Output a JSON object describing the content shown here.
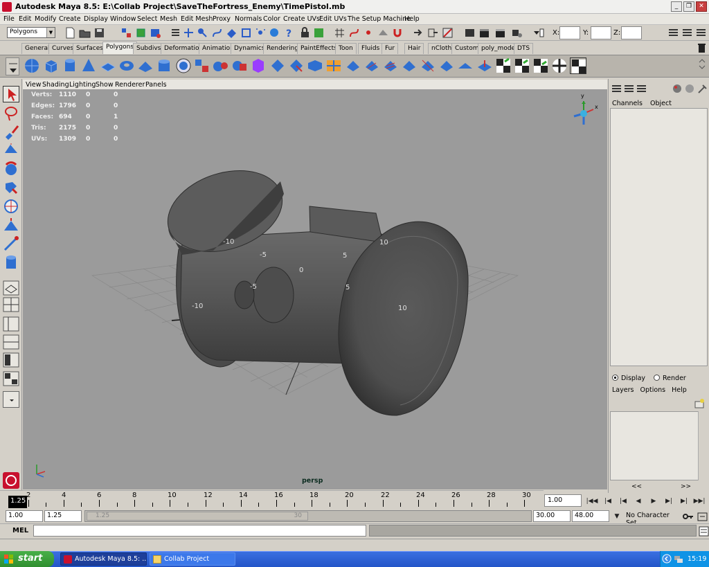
{
  "window": {
    "title": "Autodesk Maya 8.5: E:\\Collab Project\\SaveTheFortress_Enemy\\TimePistol.mb"
  },
  "menubar": [
    "File",
    "Edit",
    "Modify",
    "Create",
    "Display",
    "Window",
    "Select",
    "Mesh",
    "Edit Mesh",
    "Proxy",
    "Normals",
    "Color",
    "Create UVs",
    "Edit UVs",
    "The Setup Machine",
    "Help"
  ],
  "status_line": {
    "mode": "Polygons",
    "coord_x_label": "X:",
    "coord_y_label": "Y:",
    "coord_z_label": "Z:"
  },
  "shelf_tabs": [
    "General",
    "Curves",
    "Surfaces",
    "Polygons",
    "Subdivs",
    "Deformation",
    "Animation",
    "Dynamics",
    "Rendering",
    "PaintEffects",
    "Toon",
    "Fluids",
    "Fur",
    "Hair",
    "nCloth",
    "Custom",
    "poly_model",
    "DTS"
  ],
  "active_shelf_tab": "Polygons",
  "panel_menu": [
    "View",
    "Shading",
    "Lighting",
    "Show",
    "Renderer",
    "Panels"
  ],
  "hud": {
    "rows": [
      {
        "label": "Verts:",
        "v1": "1110",
        "v2": "0",
        "v3": "0"
      },
      {
        "label": "Edges:",
        "v1": "1796",
        "v2": "0",
        "v3": "0"
      },
      {
        "label": "Faces:",
        "v1": "694",
        "v2": "0",
        "v3": "1"
      },
      {
        "label": "Tris:",
        "v1": "2175",
        "v2": "0",
        "v3": "0"
      },
      {
        "label": "UVs:",
        "v1": "1309",
        "v2": "0",
        "v3": "0"
      }
    ]
  },
  "viewport": {
    "camera": "persp",
    "grid_labels": [
      "-10",
      "-5",
      "0",
      "5",
      "10",
      "-5",
      "5",
      "-10",
      "10"
    ],
    "axis_labels": {
      "y": "y",
      "x": "x",
      "z": "z"
    }
  },
  "channel_box": {
    "menu": [
      "Channels",
      "Object"
    ]
  },
  "layer_editor": {
    "display_label": "Display",
    "render_label": "Render",
    "menu": [
      "Layers",
      "Options",
      "Help"
    ],
    "scroll_left": "<<",
    "scroll_right": ">>"
  },
  "timeline": {
    "current_frame": "1.25",
    "tick_labels": [
      "2",
      "4",
      "6",
      "8",
      "10",
      "12",
      "14",
      "16",
      "18",
      "20",
      "22",
      "24",
      "26",
      "28",
      "30"
    ],
    "frame_field": "1.00"
  },
  "range_slider": {
    "start_time": "1.00",
    "playback_start": "1.25",
    "handle_start": "1.25",
    "handle_end": "30",
    "playback_end": "30.00",
    "end_time": "48.00",
    "character_set": "No Character Set"
  },
  "command_line": {
    "label": "MEL"
  },
  "taskbar": {
    "start_label": "start",
    "items": [
      {
        "label": "Autodesk Maya 8.5: ..."
      },
      {
        "label": "Collab Project"
      }
    ],
    "clock": "15:19"
  }
}
